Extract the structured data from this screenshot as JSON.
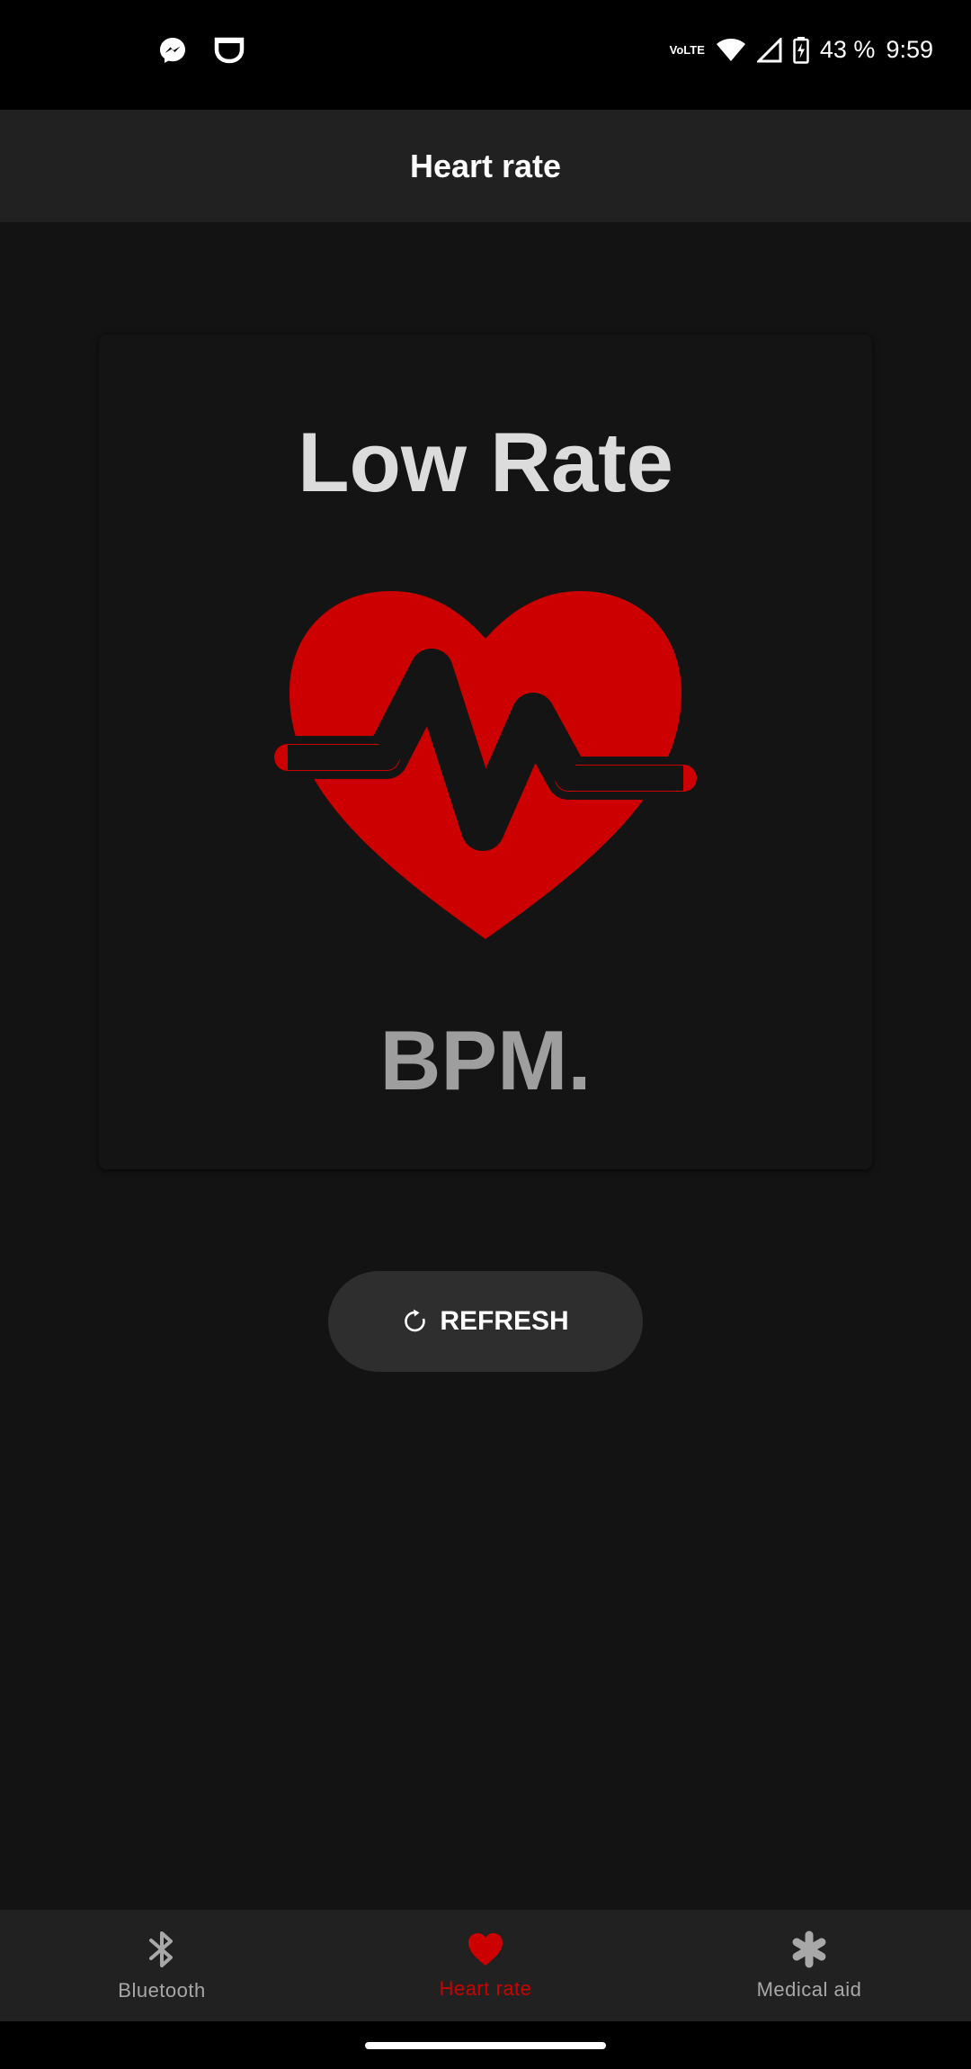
{
  "status_bar": {
    "battery_percent": "43 %",
    "time": "9:59",
    "volte_line1": "Vo",
    "volte_line2": "LTE",
    "left_icons": [
      "messenger-icon",
      "notification-app-icon"
    ],
    "right_icons": [
      "volte-icon",
      "wifi-icon",
      "signal-icon",
      "battery-charging-icon"
    ]
  },
  "app_bar": {
    "title": "Heart rate"
  },
  "card": {
    "rate_title": "Low Rate",
    "bpm_label": "BPM.",
    "heart_icon": "heart-pulse-icon"
  },
  "refresh_button": {
    "label": "REFRESH",
    "icon": "refresh-icon"
  },
  "bottom_nav": {
    "items": [
      {
        "label": "Bluetooth",
        "icon": "bluetooth-icon",
        "active": false
      },
      {
        "label": "Heart rate",
        "icon": "heart-icon",
        "active": true
      },
      {
        "label": "Medical aid",
        "icon": "asterisk-icon",
        "active": false
      }
    ]
  },
  "colors": {
    "accent": "#cc0000",
    "background": "#131313",
    "bar": "#212121",
    "button": "#2e2e2e"
  }
}
